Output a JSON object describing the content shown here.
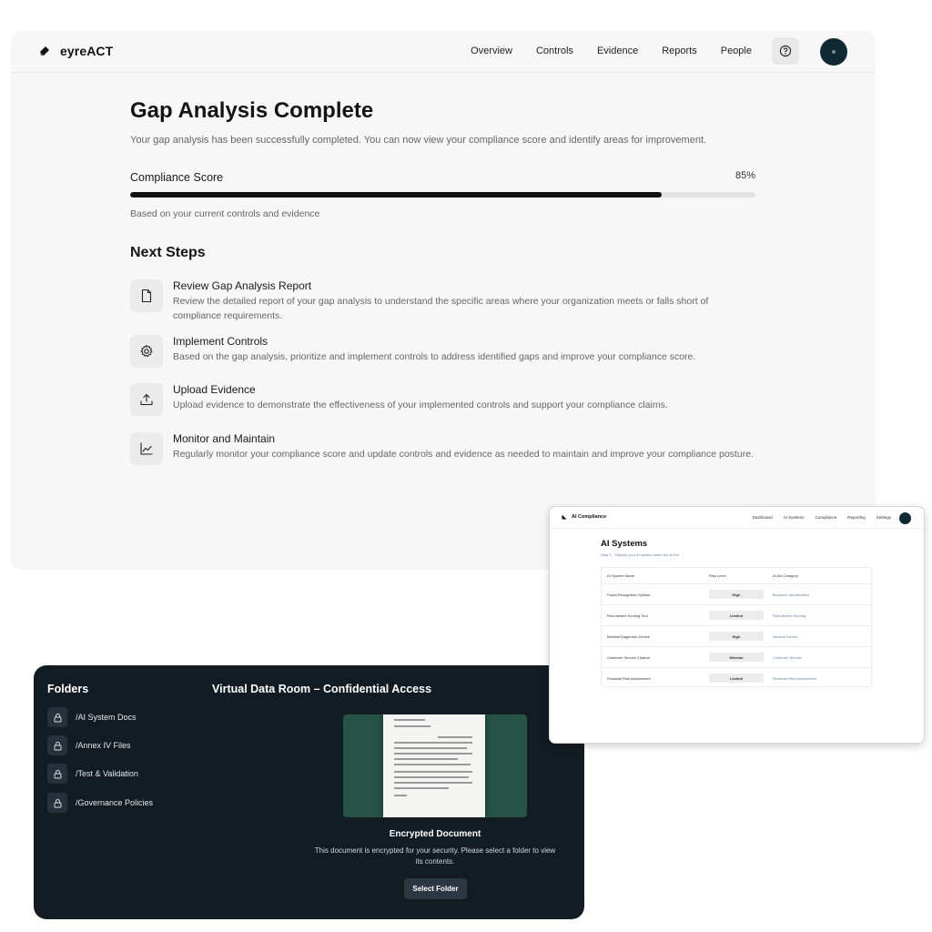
{
  "main": {
    "brand": "eyreACT",
    "nav": [
      "Overview",
      "Controls",
      "Evidence",
      "Reports",
      "People"
    ],
    "title": "Gap Analysis Complete",
    "subtitle": "Your gap analysis has been successfully completed. You can now view your compliance score and identify areas for improvement.",
    "score_label": "Compliance Score",
    "score_text": "85%",
    "score_value": 85,
    "score_note": "Based on your current controls and evidence",
    "next_steps_title": "Next Steps",
    "steps": [
      {
        "icon": "document-icon",
        "title": "Review Gap Analysis Report",
        "desc": "Review the detailed report of your gap analysis to understand the specific areas where your organization meets or falls short of compliance requirements."
      },
      {
        "icon": "gear-icon",
        "title": "Implement Controls",
        "desc": "Based on the gap analysis, prioritize and implement controls to address identified gaps and improve your compliance score."
      },
      {
        "icon": "upload-icon",
        "title": "Upload Evidence",
        "desc": "Upload evidence to demonstrate the effectiveness of your implemented controls and support your compliance claims."
      },
      {
        "icon": "chart-line-icon",
        "title": "Monitor and Maintain",
        "desc": "Regularly monitor your compliance score and update controls and evidence as needed to maintain and improve your compliance posture."
      }
    ]
  },
  "data_room": {
    "folders_title": "Folders",
    "folders": [
      "/AI System Docs",
      "/Annex IV Files",
      "/Test & Validation",
      "/Governance Policies"
    ],
    "title": "Virtual Data Room – Confidential Access",
    "doc_title": "Encrypted Document",
    "doc_desc": "This document is encrypted for your security. Please select a folder to view its contents.",
    "button": "Select Folder"
  },
  "ai_compliance": {
    "brand": "AI Compliance",
    "nav": [
      "Dashboard",
      "AI Systems",
      "Compliance",
      "Reporting",
      "Settings"
    ],
    "title": "AI Systems",
    "step": "Step 1 - Classify your AI system under the AI Act",
    "headers": [
      "AI System Name",
      "Risk Level",
      "AI Act Category"
    ],
    "rows": [
      {
        "name": "Facial Recognition System",
        "risk": "High",
        "category": "Biometric Identification"
      },
      {
        "name": "Recruitment Scoring Tool",
        "risk": "Limited",
        "category": "Recruitment Scoring"
      },
      {
        "name": "Medical Diagnostic Device",
        "risk": "High",
        "category": "Medical Device"
      },
      {
        "name": "Customer Service Chatbot",
        "risk": "Minimal",
        "category": "Customer Service"
      },
      {
        "name": "Financial Risk Assessment",
        "risk": "Limited",
        "category": "Financial Risk Assessment"
      }
    ]
  },
  "colors": {
    "accent": "#111111",
    "dark_bg": "#141c23",
    "doc_green": "#275346",
    "link_blue": "#6a7fa8"
  }
}
